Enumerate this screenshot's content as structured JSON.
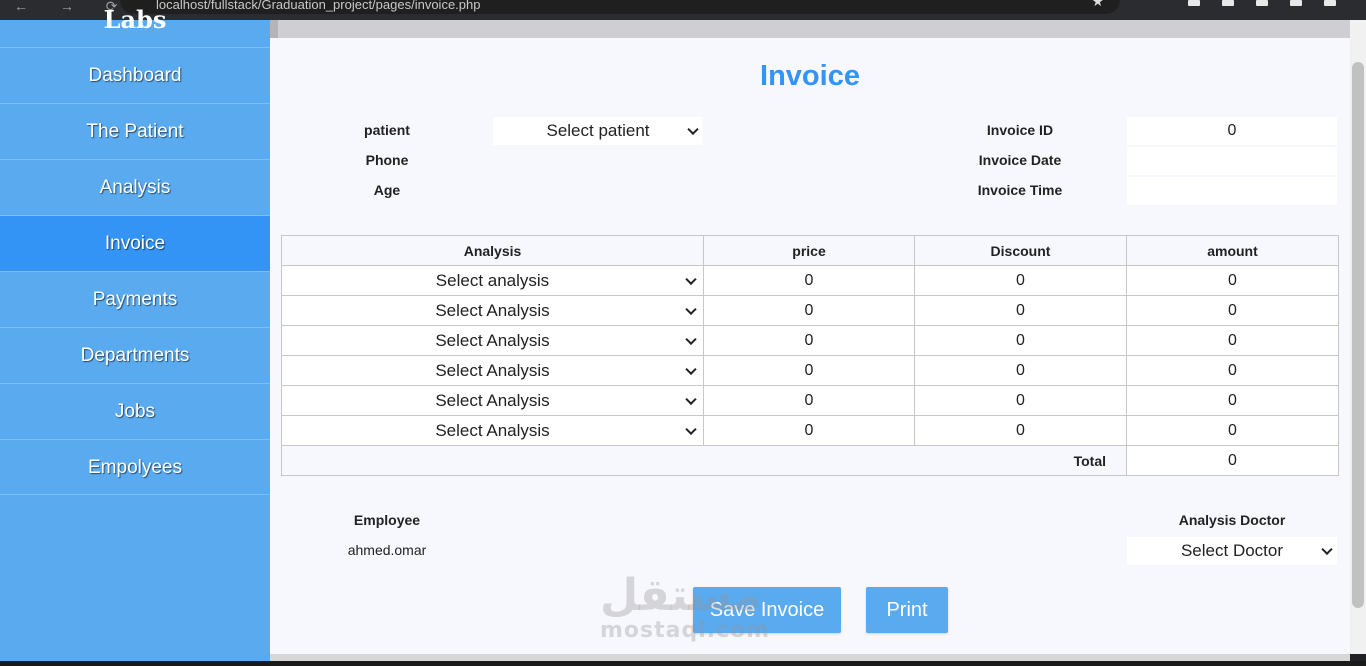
{
  "browser": {
    "url": "localhost/fullstack/Graduation_project/pages/invoice.php",
    "star_glyph": "★",
    "nav_glyphs": "← → ⟳"
  },
  "sidebar": {
    "brand": "Labs",
    "items": [
      {
        "label": "Dashboard"
      },
      {
        "label": "The Patient"
      },
      {
        "label": "Analysis"
      },
      {
        "label": "Invoice",
        "active": true
      },
      {
        "label": "Payments"
      },
      {
        "label": "Departments"
      },
      {
        "label": "Jobs"
      },
      {
        "label": "Empolyees"
      }
    ]
  },
  "invoice": {
    "title": "Invoice",
    "patient_label": "patient",
    "patient_select": "Select patient",
    "phone_label": "Phone",
    "age_label": "Age",
    "invoice_id_label": "Invoice ID",
    "invoice_id_value": "0",
    "invoice_date_label": "Invoice Date",
    "invoice_date_value": "",
    "invoice_time_label": "Invoice Time",
    "invoice_time_value": ""
  },
  "table": {
    "headers": [
      "Analysis",
      "price",
      "Discount",
      "amount"
    ],
    "rows": [
      {
        "analysis": "Select analysis",
        "price": "0",
        "discount": "0",
        "amount": "0"
      },
      {
        "analysis": "Select Analysis",
        "price": "0",
        "discount": "0",
        "amount": "0"
      },
      {
        "analysis": "Select Analysis",
        "price": "0",
        "discount": "0",
        "amount": "0"
      },
      {
        "analysis": "Select Analysis",
        "price": "0",
        "discount": "0",
        "amount": "0"
      },
      {
        "analysis": "Select Analysis",
        "price": "0",
        "discount": "0",
        "amount": "0"
      },
      {
        "analysis": "Select Analysis",
        "price": "0",
        "discount": "0",
        "amount": "0"
      }
    ],
    "total_label": "Total",
    "total_value": "0"
  },
  "footer": {
    "employee_label": "Employee",
    "employee_value": "ahmed.omar",
    "doctor_label": "Analysis Doctor",
    "doctor_select": "Select Doctor",
    "save_label": "Save Invoice",
    "print_label": "Print"
  },
  "watermark": {
    "arabic": "مستقل",
    "latin": "mostaql.com"
  },
  "colors": {
    "sidebar": "#5aaaf0",
    "active_nav": "#3394f5",
    "title": "#3394f5",
    "button": "#5aaaf0"
  }
}
